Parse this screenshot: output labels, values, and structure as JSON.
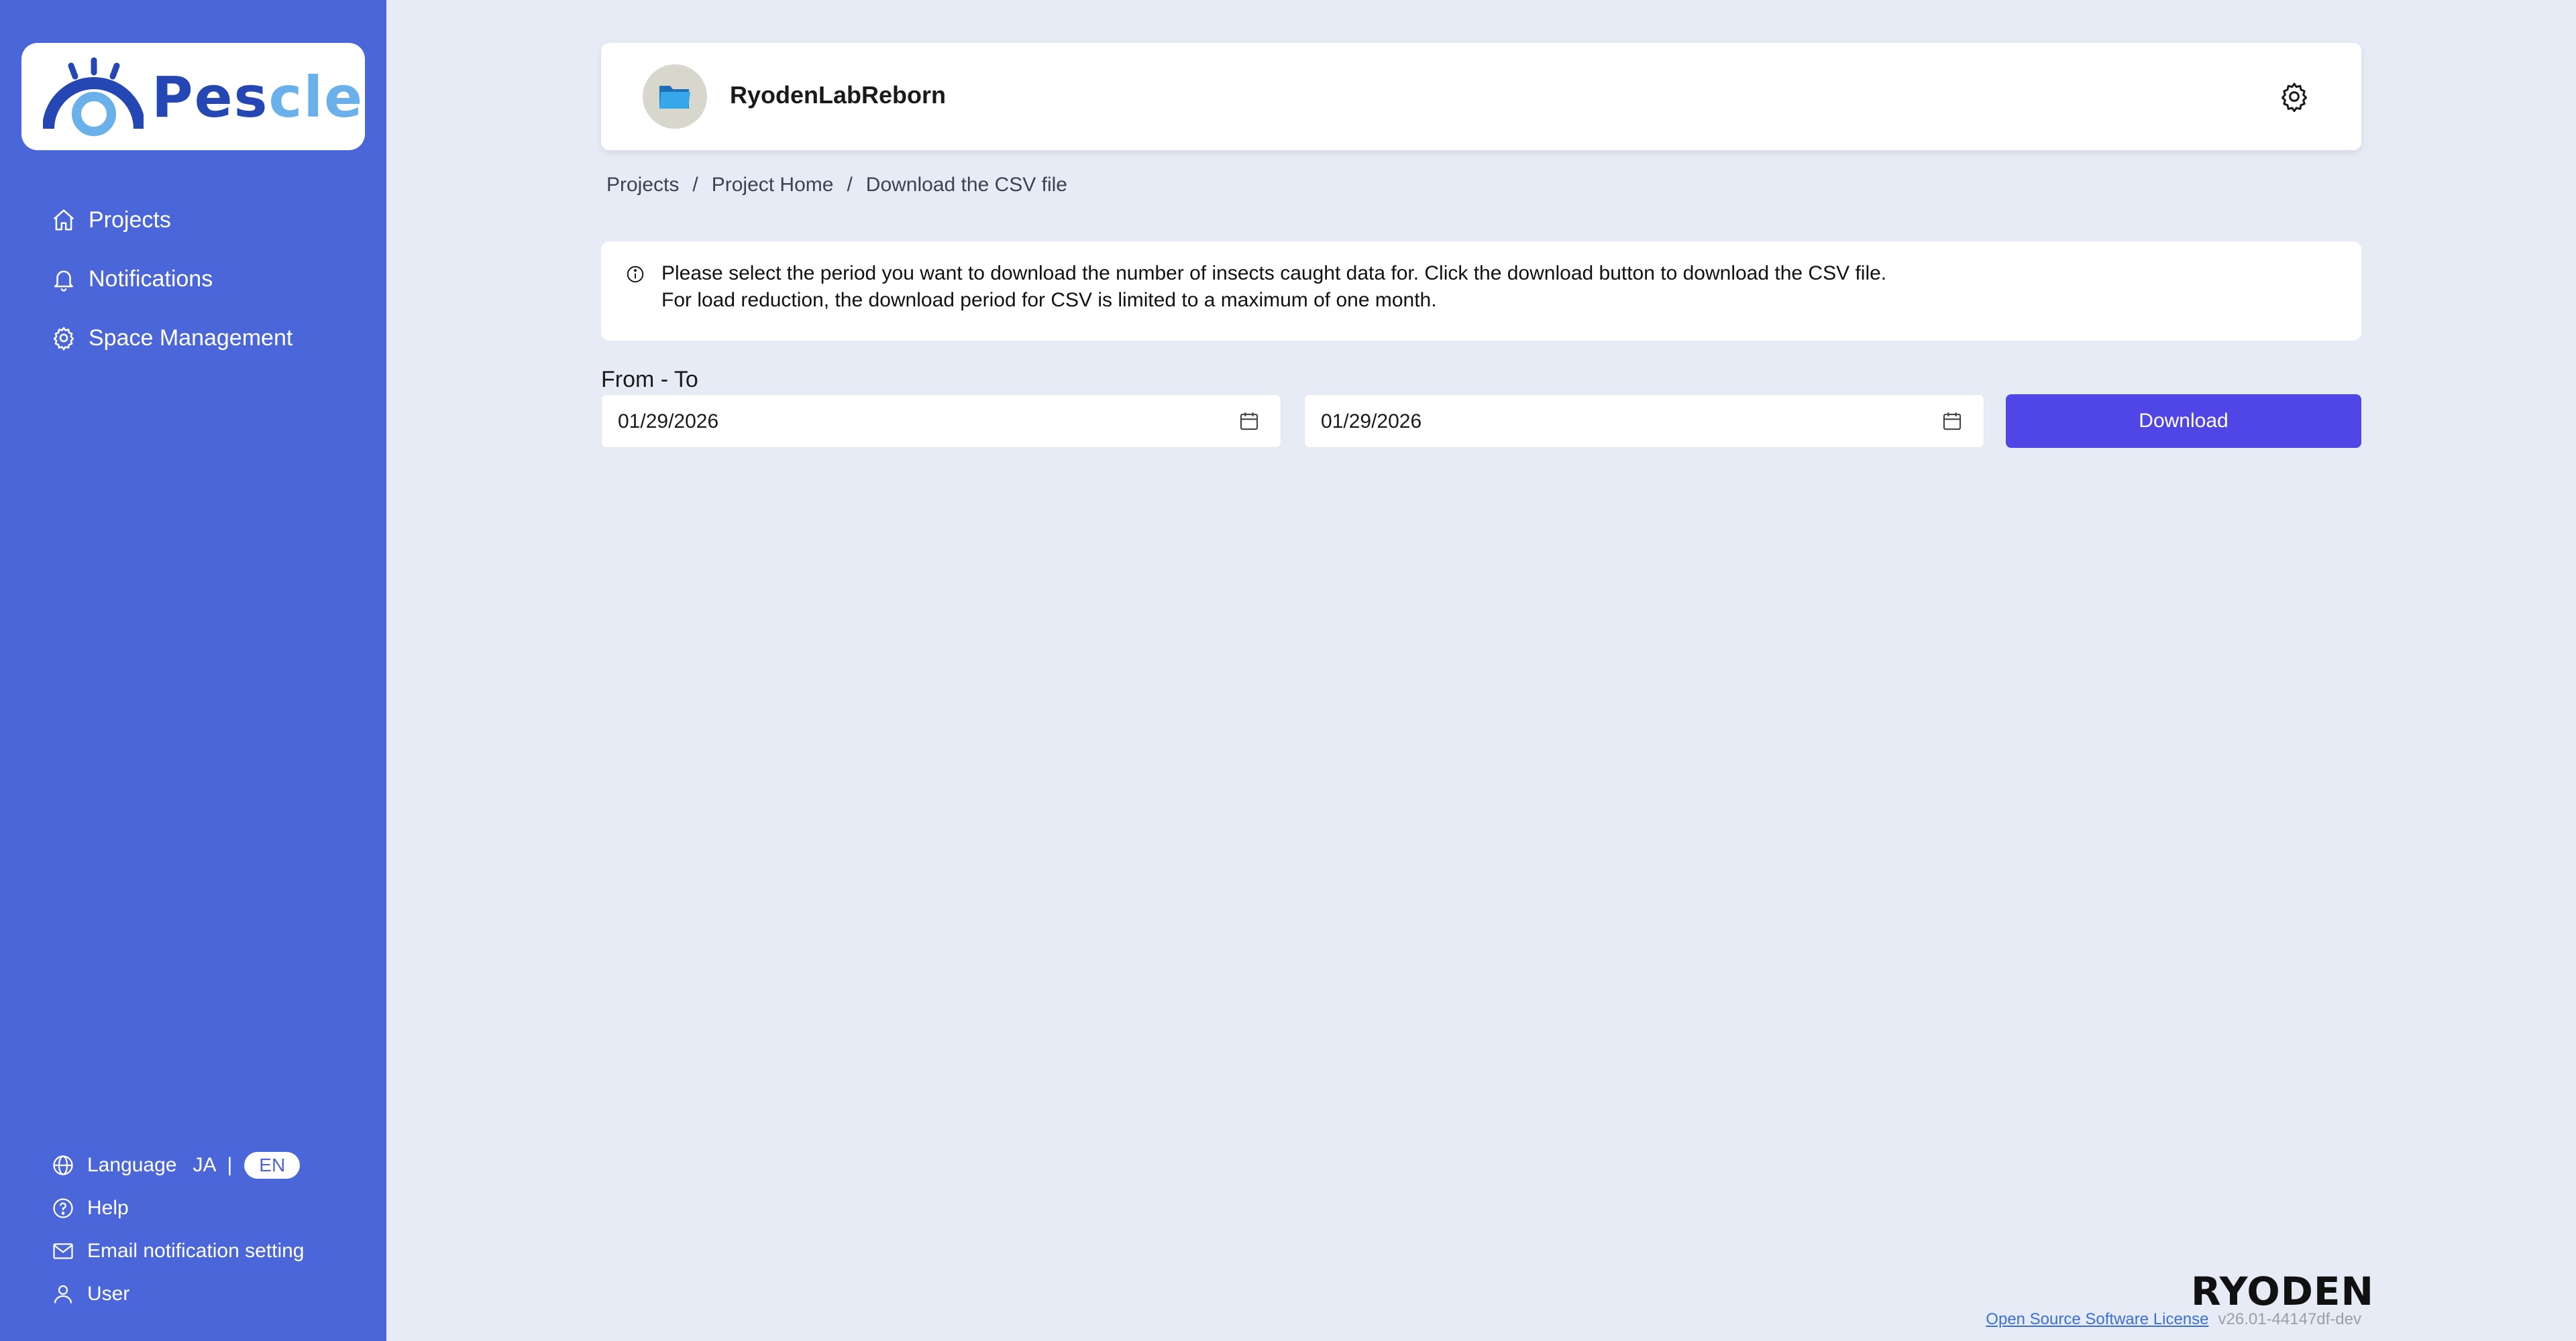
{
  "app": {
    "logo_text_dark": "Pes",
    "logo_text_light": "cle"
  },
  "sidebar": {
    "nav": [
      {
        "label": "Projects",
        "icon": "home-icon"
      },
      {
        "label": "Notifications",
        "icon": "bell-icon"
      },
      {
        "label": "Space Management",
        "icon": "gear-icon"
      }
    ],
    "bottom": {
      "language_label": "Language",
      "lang_ja": "JA",
      "lang_sep": "|",
      "lang_en": "EN",
      "help": "Help",
      "email_setting": "Email notification setting",
      "user": "User"
    }
  },
  "header": {
    "project_name": "RyodenLabReborn"
  },
  "breadcrumb": {
    "items": [
      "Projects",
      "Project Home",
      "Download the CSV file"
    ],
    "separator": "/"
  },
  "info": {
    "line1": "Please select the period you want to download the number of insects caught data for. Click the download button to download the CSV file.",
    "line2": "For load reduction, the download period for CSV is limited to a maximum of one month."
  },
  "range": {
    "label": "From - To",
    "from": "01/29/2026",
    "to": "01/29/2026"
  },
  "download_label": "Download",
  "footer": {
    "brand": "RYODEN",
    "oss_link": "Open Source Software License",
    "version": "v26.01-44147df-dev"
  },
  "colors": {
    "sidebar": "#4a66d8",
    "background": "#e6ebf5",
    "primary_button": "#4f46e5",
    "logo_dark": "#2447b3",
    "logo_light": "#6ab0ea"
  }
}
